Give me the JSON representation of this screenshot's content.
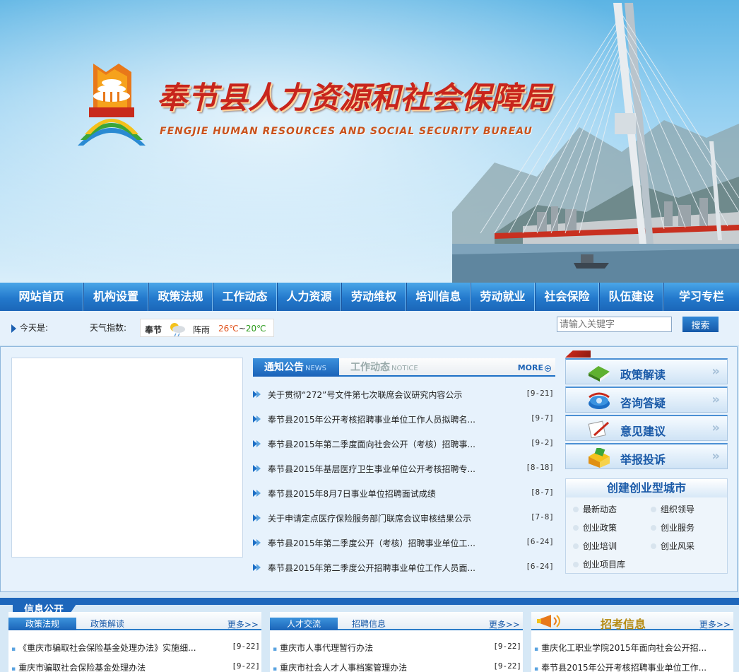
{
  "header": {
    "title": "奉节县人力资源和社会保障局",
    "subtitle": "FENGJIE HUMAN RESOURCES AND SOCIAL SECURITY  BUREAU"
  },
  "nav": [
    "网站首页",
    "机构设置",
    "政策法规",
    "工作动态",
    "人力资源",
    "劳动维权",
    "培训信息",
    "劳动就业",
    "社会保险",
    "队伍建设",
    "学习专栏"
  ],
  "infobar": {
    "today_label": "今天是:",
    "weather_label": "天气指数:",
    "weather_city": "奉节",
    "weather_condition": "阵雨",
    "temp_high": "26℃",
    "temp_sep": "~",
    "temp_low": "20℃",
    "search_placeholder": "请输入关键字",
    "search_button": "搜索"
  },
  "news": {
    "tab_active": "通知公告",
    "tab_active_en": "NEWS",
    "tab_inactive": "工作动态",
    "tab_inactive_en": "NOTICE",
    "more": "MORE",
    "items": [
      {
        "title": "关于贯彻“272”号文件第七次联席会议研究内容公示",
        "date": "[9-21]"
      },
      {
        "title": "奉节县2015年公开考核招聘事业单位工作人员拟聘名...",
        "date": "[9-7]"
      },
      {
        "title": "奉节县2015年第二季度面向社会公开（考核）招聘事...",
        "date": "[9-2]"
      },
      {
        "title": "奉节县2015年基层医疗卫生事业单位公开考核招聘专...",
        "date": "[8-18]"
      },
      {
        "title": "奉节县2015年8月7日事业单位招聘面试成绩",
        "date": "[8-7]"
      },
      {
        "title": "关于申请定点医疗保险服务部门联席会议审核结果公示",
        "date": "[7-8]"
      },
      {
        "title": "奉节县2015年第二季度公开（考核）招聘事业单位工...",
        "date": "[6-24]"
      },
      {
        "title": "奉节县2015年第二季度公开招聘事业单位工作人员面...",
        "date": "[6-24]"
      }
    ]
  },
  "quicklinks": [
    "政策解读",
    "咨询答疑",
    "意见建议",
    "举报投诉"
  ],
  "startup": {
    "title": "创建创业型城市",
    "links": [
      "最新动态",
      "组织领导",
      "创业政策",
      "创业服务",
      "创业培训",
      "创业风采",
      "创业项目库"
    ]
  },
  "bottom": {
    "section_label": "信息公开",
    "panel1": {
      "tab_on": "政策法规",
      "tab_off": "政策解读",
      "more": "更多>>",
      "rows": [
        {
          "title": "《重庆市骗取社会保险基金处理办法》实施细...",
          "date": "[9-22]"
        },
        {
          "title": "重庆市骗取社会保险基金处理办法",
          "date": "[9-22]"
        }
      ]
    },
    "panel2": {
      "tab_on": "人才交流",
      "tab_off": "招聘信息",
      "more": "更多>>",
      "rows": [
        {
          "title": "重庆市人事代理暂行办法",
          "date": "[9-22]"
        },
        {
          "title": "重庆市社会人才人事档案管理办法",
          "date": "[9-22]"
        }
      ]
    },
    "panel3": {
      "title": "招考信息",
      "more": "更多>>",
      "rows": [
        {
          "title": "重庆化工职业学院2015年面向社会公开招...",
          "date": ""
        },
        {
          "title": "奉节县2015年公开考核招聘事业单位工作...",
          "date": ""
        }
      ]
    }
  }
}
